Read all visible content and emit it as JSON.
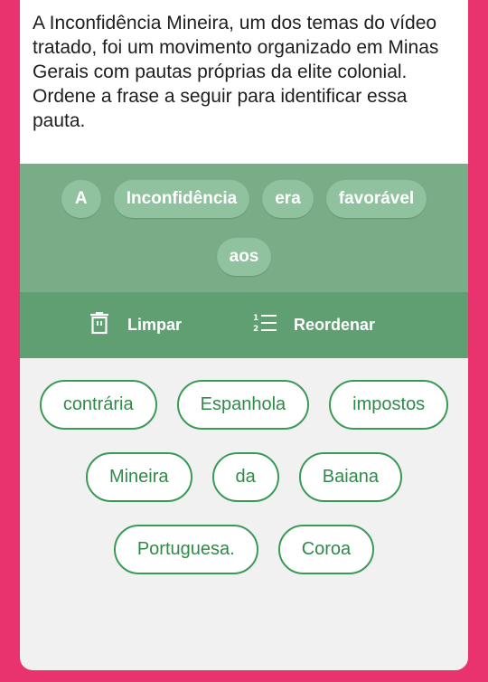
{
  "question": {
    "text": "A Inconfidência Mineira, um dos temas do vídeo tratado, foi um movimento organizado em Minas Gerais com pautas próprias da elite colonial. Ordene a frase a seguir para identificar essa pauta."
  },
  "selected_words": [
    "A",
    "Inconfidência",
    "era",
    "favorável",
    "aos"
  ],
  "toolbar": {
    "clear_label": "Limpar",
    "clear_icon": "trash-icon",
    "reorder_label": "Reordenar",
    "reorder_icon": "numbered-list-icon"
  },
  "word_bank": [
    "contrária",
    "Espanhola",
    "impostos",
    "Mineira",
    "da",
    "Baiana",
    "Portuguesa.",
    "Coroa"
  ],
  "colors": {
    "background": "#e8336f",
    "answer_area": "#78ad88",
    "toolbar": "#5f9f71",
    "chip_border": "#3a9a55"
  }
}
